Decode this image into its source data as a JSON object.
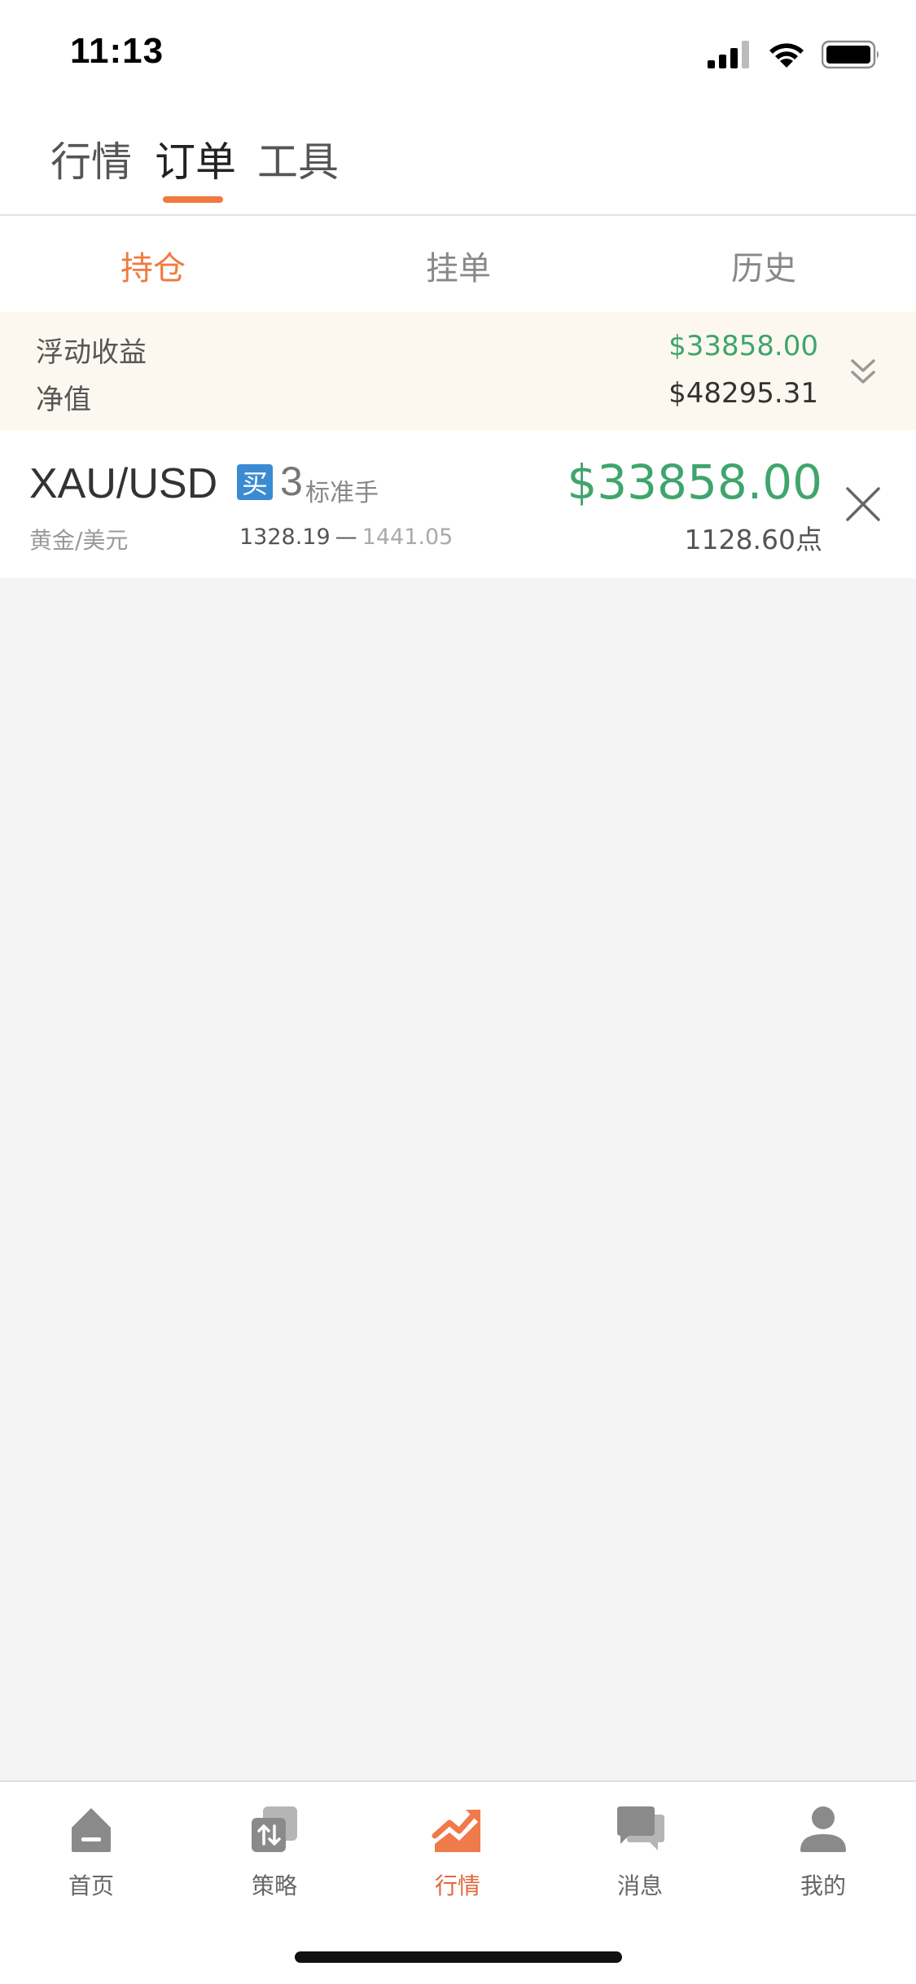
{
  "status_bar": {
    "time": "11:13"
  },
  "top_tabs": [
    {
      "label": "行情",
      "active": false
    },
    {
      "label": "订单",
      "active": true
    },
    {
      "label": "工具",
      "active": false
    }
  ],
  "sub_tabs": [
    {
      "label": "持仓",
      "active": true
    },
    {
      "label": "挂单",
      "active": false
    },
    {
      "label": "历史",
      "active": false
    }
  ],
  "summary": {
    "floating_pl_label": "浮动收益",
    "floating_pl_value": "$33858.00",
    "equity_label": "净值",
    "equity_value": "$48295.31"
  },
  "position": {
    "symbol": "XAU/USD",
    "symbol_cn": "黄金/美元",
    "side_badge": "买",
    "lots": "3",
    "lot_unit": "标准手",
    "open_price": "1328.19",
    "separator": "—",
    "current_price": "1441.05",
    "profit": "$33858.00",
    "points": "1128.60点"
  },
  "tab_bar": [
    {
      "label": "首页",
      "icon": "home-icon",
      "active": false
    },
    {
      "label": "策略",
      "icon": "strategy-icon",
      "active": false
    },
    {
      "label": "行情",
      "icon": "market-chart-icon",
      "active": true
    },
    {
      "label": "消息",
      "icon": "message-icon",
      "active": false
    },
    {
      "label": "我的",
      "icon": "profile-icon",
      "active": false
    }
  ],
  "colors": {
    "accent": "#f07a3d",
    "profit_green": "#3fa56c",
    "buy_blue": "#3b8bd3",
    "summary_bg": "#fdf8ef"
  }
}
